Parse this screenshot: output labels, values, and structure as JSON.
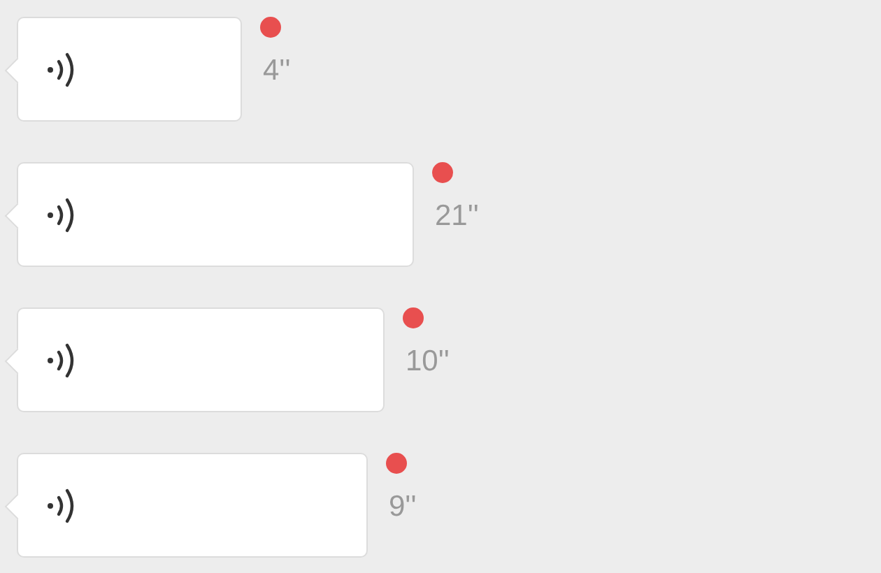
{
  "messages": [
    {
      "duration": "4''",
      "unread": true
    },
    {
      "duration": "21''",
      "unread": true
    },
    {
      "duration": "10''",
      "unread": true
    },
    {
      "duration": "9''",
      "unread": true
    }
  ]
}
